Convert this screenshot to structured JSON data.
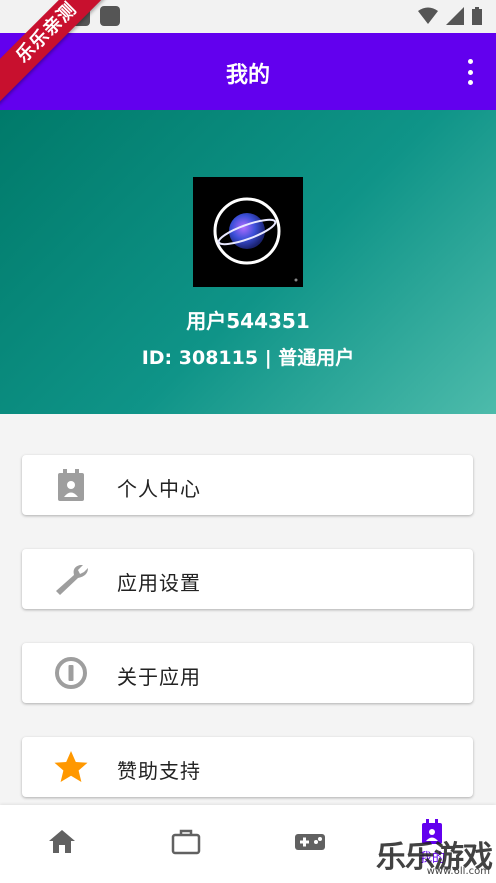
{
  "watermark_ribbon": "乐乐亲测",
  "app_bar": {
    "title": "我的"
  },
  "profile": {
    "username": "用户544351",
    "user_info": "ID: 308115 | 普通用户"
  },
  "menu": [
    {
      "label": "个人中心",
      "icon": "profile-card-icon"
    },
    {
      "label": "应用设置",
      "icon": "wrench-icon"
    },
    {
      "label": "关于应用",
      "icon": "info-icon"
    },
    {
      "label": "赞助支持",
      "icon": "star-icon"
    }
  ],
  "bottom_nav": [
    {
      "icon": "home-icon"
    },
    {
      "icon": "briefcase-icon"
    },
    {
      "icon": "gamepad-icon"
    },
    {
      "icon": "profile-card-icon",
      "label": "我的",
      "active": true
    }
  ],
  "watermark": {
    "brand": "乐乐游戏",
    "url": "www.6ll.com"
  },
  "colors": {
    "primary": "#6200ee",
    "teal": "#0f9488",
    "star": "#ff9800",
    "icon_gray": "#9e9e9e"
  }
}
